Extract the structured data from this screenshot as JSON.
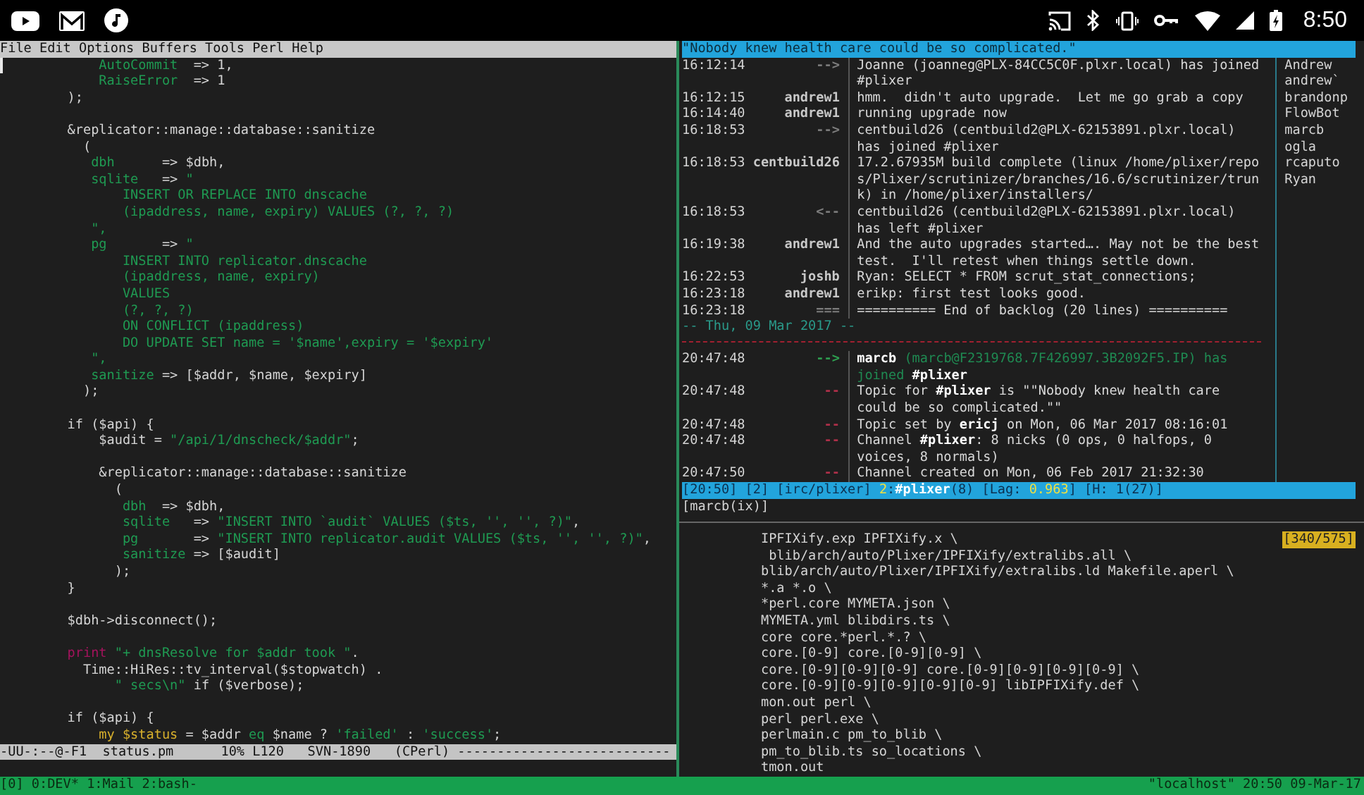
{
  "status_bar": {
    "time": "8:50"
  },
  "editor": {
    "menu": [
      "File",
      "Edit",
      "Options",
      "Buffers",
      "Tools",
      "Perl",
      "Help"
    ],
    "code_blocks": [
      [
        [
          {
            "kind": "string",
            "text": "            AutoCommit"
          },
          {
            "kind": "plain",
            "text": "  => 1,"
          }
        ],
        [
          {
            "kind": "string",
            "text": "            RaiseError"
          },
          {
            "kind": "plain",
            "text": "  => 1"
          }
        ],
        [
          {
            "kind": "plain",
            "text": "        );"
          }
        ]
      ],
      [
        [
          {
            "kind": "plain",
            "text": "        &replicator::manage::database::sanitize"
          }
        ],
        [
          {
            "kind": "plain",
            "text": "          ("
          }
        ],
        [
          {
            "kind": "string",
            "text": "           dbh"
          },
          {
            "kind": "plain",
            "text": "      => $dbh,"
          }
        ],
        [
          {
            "kind": "string",
            "text": "           sqlite"
          },
          {
            "kind": "plain",
            "text": "   => "
          },
          {
            "kind": "string",
            "text": "\""
          }
        ],
        [
          {
            "kind": "string",
            "text": "               INSERT OR REPLACE INTO dnscache"
          }
        ],
        [
          {
            "kind": "string",
            "text": "               (ipaddress, name, expiry) VALUES (?, ?, ?)"
          }
        ],
        [
          {
            "kind": "string",
            "text": "           \","
          }
        ],
        [
          {
            "kind": "string",
            "text": "           pg"
          },
          {
            "kind": "plain",
            "text": "       => "
          },
          {
            "kind": "string",
            "text": "\""
          }
        ],
        [
          {
            "kind": "string",
            "text": "               INSERT INTO replicator.dnscache"
          }
        ],
        [
          {
            "kind": "string",
            "text": "               (ipaddress, name, expiry)"
          }
        ],
        [
          {
            "kind": "string",
            "text": "               VALUES"
          }
        ],
        [
          {
            "kind": "string",
            "text": "               (?, ?, ?)"
          }
        ],
        [
          {
            "kind": "string",
            "text": "               ON CONFLICT (ipaddress)"
          }
        ],
        [
          {
            "kind": "string",
            "text": "               DO UPDATE SET name = '$name',expiry = '$expiry'"
          }
        ],
        [
          {
            "kind": "string",
            "text": "           \","
          }
        ],
        [
          {
            "kind": "string",
            "text": "           sanitize"
          },
          {
            "kind": "plain",
            "text": " => [$addr, $name, $expiry]"
          }
        ],
        [
          {
            "kind": "plain",
            "text": "          );"
          }
        ]
      ],
      [
        [
          {
            "kind": "plain",
            "text": "        if ($api) {"
          }
        ],
        [
          {
            "kind": "plain",
            "text": "            $audit = "
          },
          {
            "kind": "string",
            "text": "\"/api/1/dnscheck/$addr\""
          },
          {
            "kind": "plain",
            "text": ";"
          }
        ]
      ],
      [
        [
          {
            "kind": "plain",
            "text": "            &replicator::manage::database::sanitize"
          }
        ],
        [
          {
            "kind": "plain",
            "text": "              ("
          }
        ],
        [
          {
            "kind": "string",
            "text": "               dbh"
          },
          {
            "kind": "plain",
            "text": "  => $dbh,"
          }
        ],
        [
          {
            "kind": "string",
            "text": "               sqlite"
          },
          {
            "kind": "plain",
            "text": "   => "
          },
          {
            "kind": "string",
            "text": "\"INSERT INTO `audit` VALUES ($ts, '', '', ?)\""
          },
          {
            "kind": "plain",
            "text": ","
          }
        ],
        [
          {
            "kind": "string",
            "text": "               pg"
          },
          {
            "kind": "plain",
            "text": "       => "
          },
          {
            "kind": "string",
            "text": "\"INSERT INTO replicator.audit VALUES ($ts, '', '', ?)\""
          },
          {
            "kind": "plain",
            "text": ","
          }
        ],
        [
          {
            "kind": "string",
            "text": "               sanitize"
          },
          {
            "kind": "plain",
            "text": " => [$audit]"
          }
        ],
        [
          {
            "kind": "plain",
            "text": "              );"
          }
        ],
        [
          {
            "kind": "plain",
            "text": "        }"
          }
        ]
      ],
      [
        [
          {
            "kind": "plain",
            "text": "        $dbh->disconnect();"
          }
        ]
      ],
      [
        [
          {
            "kind": "keyword",
            "text": "        print"
          },
          {
            "kind": "string",
            "text": " \"+ dnsResolve for $addr took \""
          },
          {
            "kind": "plain",
            "text": "."
          }
        ],
        [
          {
            "kind": "plain",
            "text": "          Time::HiRes::tv_interval($stopwatch) ."
          }
        ],
        [
          {
            "kind": "string",
            "text": "              \" secs\\n\""
          },
          {
            "kind": "plain",
            "text": " if ($verbose);"
          }
        ]
      ],
      [
        [
          {
            "kind": "plain",
            "text": "        if ($api) {"
          }
        ],
        [
          {
            "kind": "variable",
            "text": "            my $status"
          },
          {
            "kind": "plain",
            "text": " = $addr "
          },
          {
            "kind": "string",
            "text": "eq"
          },
          {
            "kind": "plain",
            "text": " $name ? "
          },
          {
            "kind": "string",
            "text": "'failed'"
          },
          {
            "kind": "plain",
            "text": " : "
          },
          {
            "kind": "string",
            "text": "'success'"
          },
          {
            "kind": "plain",
            "text": ";"
          }
        ]
      ]
    ],
    "mode_line": "-UU-:--@-F1  status.pm      10% L120   SVN-1890   (CPerl) ---------------------------"
  },
  "irc": {
    "topic": "\"Nobody knew health care could be so complicated.\"",
    "chat": [
      {
        "kind": "message",
        "time": "16:12:14",
        "prefix": "-->",
        "color": "#7c7c7c",
        "joined": false,
        "lines": [
          "Joanne (joanneg@PLX-84CC5C0F.plxr.local) has joined",
          "#plixer"
        ]
      },
      {
        "kind": "message",
        "time": "16:12:15",
        "prefix": "andrew1",
        "color": "#c8c8c8",
        "joined": false,
        "lines": [
          "hmm.  didn't auto upgrade.  Let me go grab a copy"
        ]
      },
      {
        "kind": "message",
        "time": "16:14:40",
        "prefix": "andrew1",
        "color": "#c8c8c8",
        "joined": false,
        "lines": [
          "running upgrade now"
        ]
      },
      {
        "kind": "message",
        "time": "16:18:53",
        "prefix": "-->",
        "color": "#7c7c7c",
        "joined": false,
        "lines": [
          "centbuild26 (centbuild2@PLX-62153891.plxr.local)",
          "has joined #plixer"
        ]
      },
      {
        "kind": "message",
        "time": "16:18:53",
        "prefix": "centbuild26",
        "color": "#c8c8c8",
        "joined": false,
        "lines": [
          "17.2.67935M build complete (linux /home/plixer/repo",
          "s/Plixer/scrutinizer/branches/16.6/scrutinizer/trun",
          "k) in /home/plixer/installers/"
        ]
      },
      {
        "kind": "message",
        "time": "16:18:53",
        "prefix": "<--",
        "color": "#7c7c7c",
        "joined": false,
        "lines": [
          "centbuild26 (centbuild2@PLX-62153891.plxr.local)",
          "has left #plixer"
        ]
      },
      {
        "kind": "message",
        "time": "16:19:38",
        "prefix": "andrew1",
        "color": "#c8c8c8",
        "joined": false,
        "lines": [
          "And the auto upgrades started…. May not be the best",
          "test.  I'll retest when things settle down."
        ]
      },
      {
        "kind": "message",
        "time": "16:22:53",
        "prefix": "joshb",
        "color": "#c8c8c8",
        "joined": false,
        "lines": [
          "Ryan: SELECT * FROM scrut_stat_connections;"
        ]
      },
      {
        "kind": "message",
        "time": "16:23:18",
        "prefix": "andrew1",
        "color": "#c8c8c8",
        "joined": false,
        "lines": [
          "erikp: first test looks good."
        ]
      },
      {
        "kind": "message",
        "time": "16:23:18",
        "prefix": "===",
        "color": "#7c7c7c",
        "joined": false,
        "lines": [
          "========== End of backlog (20 lines) =========="
        ]
      },
      {
        "kind": "date",
        "text": "-- Thu, 09 Mar 2017 --"
      },
      {
        "kind": "message",
        "time": "20:47:48",
        "prefix": "-->",
        "color": "#2e9e50",
        "joined": true,
        "lines": [
          "**marcb** (marcb@F2319768.7F426997.3B2092F5.IP) has",
          "joined **#plixer**"
        ]
      },
      {
        "kind": "message",
        "time": "20:47:48",
        "prefix": "--",
        "color": "#b0304a",
        "joined": false,
        "lines": [
          "Topic for **#plixer** is \"\"Nobody knew health care",
          "could be so complicated.\"\""
        ]
      },
      {
        "kind": "message",
        "time": "20:47:48",
        "prefix": "--",
        "color": "#b0304a",
        "joined": false,
        "lines": [
          "Topic set by **ericj** on Mon, 06 Mar 2017 08:16:01"
        ]
      },
      {
        "kind": "message",
        "time": "20:47:48",
        "prefix": "--",
        "color": "#b0304a",
        "joined": false,
        "lines": [
          "Channel **#plixer**: 8 nicks (0 ops, 0 halfops, 0",
          "voices, 8 normals)"
        ]
      },
      {
        "kind": "message",
        "time": "20:47:50",
        "prefix": "--",
        "color": "#b0304a",
        "joined": false,
        "lines": [
          "Channel created on Mon, 06 Feb 2017 21:32:30"
        ]
      }
    ],
    "nicks": [
      "Andrew",
      "andrew`",
      "brandonp",
      "FlowBot",
      "marcb",
      "ogla",
      "rcaputo",
      "Ryan"
    ],
    "status": [
      {
        "kind": "dim",
        "text": "[20:50] [2] [irc/plixer] "
      },
      {
        "kind": "hot",
        "text": "2"
      },
      {
        "kind": "dim",
        "text": ":"
      },
      {
        "kind": "bold",
        "text": "#plixer"
      },
      {
        "kind": "dim",
        "text": "(8) [Lag: "
      },
      {
        "kind": "hot",
        "text": "0.963"
      },
      {
        "kind": "dim",
        "text": "] [H: 1(27)]"
      }
    ],
    "prompt": "[marcb(ix)]"
  },
  "shell": {
    "position": "[340/575]",
    "lines": [
      "          IPFIXify.exp IPFIXify.x \\",
      "           blib/arch/auto/Plixer/IPFIXify/extralibs.all \\",
      "          blib/arch/auto/Plixer/IPFIXify/extralibs.ld Makefile.aperl \\",
      "          *.a *.o \\",
      "          *perl.core MYMETA.json \\",
      "          MYMETA.yml blibdirs.ts \\",
      "          core core.*perl.*.? \\",
      "          core.[0-9] core.[0-9][0-9] \\",
      "          core.[0-9][0-9][0-9] core.[0-9][0-9][0-9][0-9] \\",
      "          core.[0-9][0-9][0-9][0-9][0-9] libIPFIXify.def \\",
      "          mon.out perl \\",
      "          perl perl.exe \\",
      "          perlmain.c pm_to_blib \\",
      "          pm_to_blib.ts so_locations \\",
      "          tmon.out"
    ]
  },
  "tmux": {
    "session": "[0]",
    "windows": [
      "0:DEV*",
      "1:Mail",
      "2:bash-"
    ],
    "right": "\"localhost\" 20:50 09-Mar-17"
  }
}
